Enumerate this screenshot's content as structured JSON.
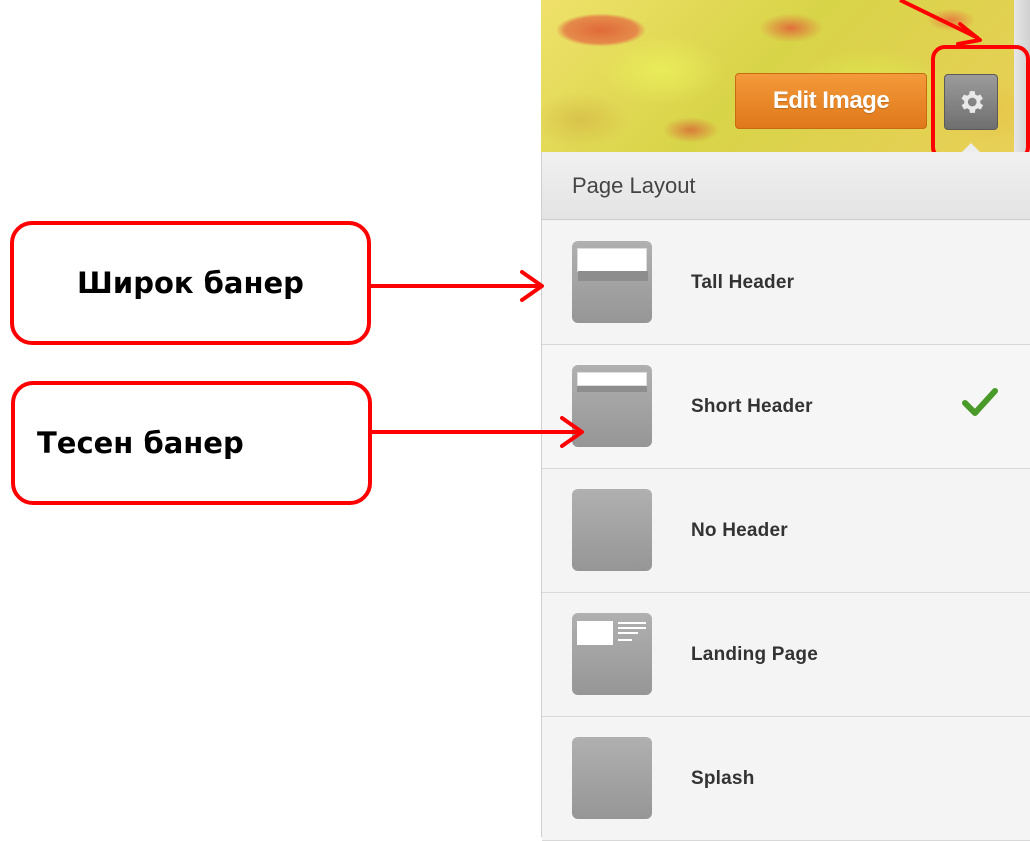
{
  "header": {
    "edit_image_label": "Edit Image",
    "settings_icon": "gear-icon"
  },
  "panel": {
    "title": "Page Layout",
    "items": [
      {
        "label": "Tall Header",
        "thumbnail": "tall-header-thumbnail",
        "selected": false
      },
      {
        "label": "Short Header",
        "thumbnail": "short-header-thumbnail",
        "selected": true
      },
      {
        "label": "No Header",
        "thumbnail": "no-header-thumbnail",
        "selected": false
      },
      {
        "label": "Landing Page",
        "thumbnail": "landing-page-thumbnail",
        "selected": false
      },
      {
        "label": "Splash",
        "thumbnail": "splash-thumbnail",
        "selected": false
      }
    ],
    "selected_check_icon": "checkmark-icon"
  },
  "annotations": {
    "wide_banner": "Широк банер",
    "narrow_banner": "Тесен банер"
  },
  "colors": {
    "edit_button": "#e8841f",
    "annotation": "#ff0000",
    "check": "#4a9a2a"
  }
}
